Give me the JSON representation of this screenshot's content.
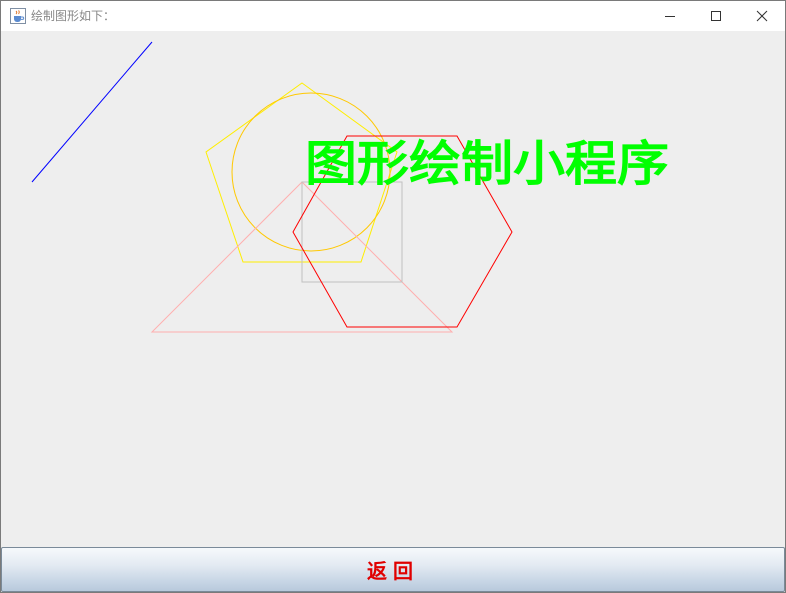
{
  "window": {
    "title": "绘制图形如下：",
    "controls": {
      "minimize": "minimize-icon",
      "maximize": "maximize-icon",
      "close": "close-icon"
    }
  },
  "canvas": {
    "heading_text": "图形绘制小程序",
    "colors": {
      "background": "#eeeeee",
      "line": "#0000ff",
      "pentagon": "#ffee00",
      "circle": "#ffc800",
      "triangle": "#ffafaf",
      "square": "#c0c0c0",
      "hexagon": "#ff0000",
      "heading": "#00ff00"
    },
    "shapes": [
      "line",
      "pentagon",
      "circle",
      "triangle",
      "square",
      "hexagon",
      "text"
    ]
  },
  "footer": {
    "return_label": "返回"
  }
}
